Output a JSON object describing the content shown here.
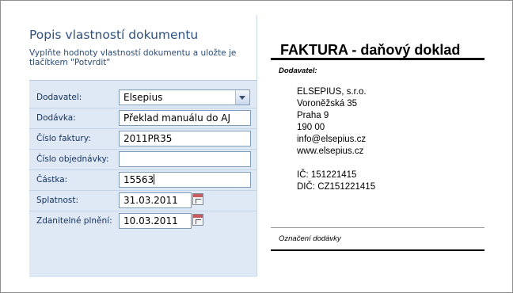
{
  "panel": {
    "title": "Popis vlastností dokumentu",
    "description": "Vyplňte hodnoty vlastností dokumentu a uložte je tlačítkem \"Potvrdit\""
  },
  "form": {
    "rows": [
      {
        "label": "Dodavatel:",
        "value": "Elsepius",
        "type": "select"
      },
      {
        "label": "Dodávka:",
        "value": "Překlad manuálu do AJ",
        "type": "text"
      },
      {
        "label": "Číslo faktury:",
        "value": "2011PR35",
        "type": "text"
      },
      {
        "label": "Číslo objednávky:",
        "value": "",
        "type": "text"
      },
      {
        "label": "Částka:",
        "value": "15563",
        "type": "text"
      },
      {
        "label": "Splatnost:",
        "value": "31.03.2011",
        "type": "date"
      },
      {
        "label": "Zdanitelné plnění:",
        "value": "10.03.2011",
        "type": "date"
      }
    ]
  },
  "invoice": {
    "title": "FAKTURA - daňový doklad",
    "supplier_heading": "Dodavatel:",
    "address_lines": [
      "ELSEPIUS, s.r.o.",
      "Voroněžská 35",
      "Praha 9",
      "190 00",
      "info@elsepius.cz",
      "www.elsepius.cz",
      "",
      "IČ: 151221415",
      "DIČ: CZ151221415"
    ],
    "footer_label": "Označení dodávky"
  }
}
